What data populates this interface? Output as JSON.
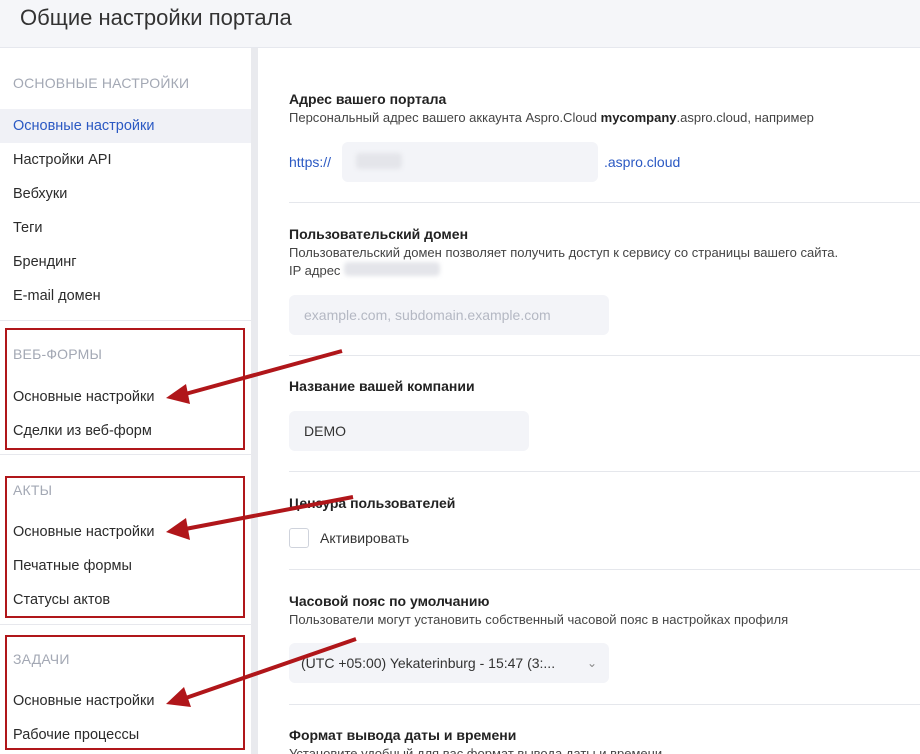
{
  "header": {
    "title": "Общие настройки портала"
  },
  "sidebar": {
    "sections": [
      {
        "title": "ОСНОВНЫЕ НАСТРОЙКИ",
        "items": [
          "Основные настройки",
          "Настройки API",
          "Вебхуки",
          "Теги",
          "Брендинг",
          "E-mail домен"
        ]
      },
      {
        "title": "ВЕБ-ФОРМЫ",
        "items": [
          "Основные настройки",
          "Сделки из веб-форм"
        ]
      },
      {
        "title": "АКТЫ",
        "items": [
          "Основные настройки",
          "Печатные формы",
          "Статусы актов"
        ]
      },
      {
        "title": "ЗАДАЧИ",
        "items": [
          "Основные настройки",
          "Рабочие процессы"
        ]
      }
    ]
  },
  "main": {
    "portal": {
      "label": "Адрес вашего портала",
      "desc_prefix": "Персональный адрес вашего аккаунта Aspro.Cloud ",
      "desc_bold": "mycompany",
      "desc_suffix": ".aspro.cloud, например",
      "prefix": "https://",
      "suffix": ".aspro.cloud"
    },
    "domain": {
      "label": "Пользовательский домен",
      "desc": "Пользовательский домен позволяет получить доступ к сервису со страницы вашего сайта.",
      "ip_label": "IP адрес",
      "placeholder": "example.com, subdomain.example.com"
    },
    "company": {
      "label": "Название вашей компании",
      "value": "DEMO"
    },
    "censor": {
      "label": "Цензура пользователей",
      "checkbox_label": "Активировать"
    },
    "timezone": {
      "label": "Часовой пояс по умолчанию",
      "desc": "Пользователи могут установить собственный часовой пояс в настройках профиля",
      "value": "(UTC +05:00) Yekaterinburg - 15:47 (3:...",
      "chevron": "chevron-down-icon"
    },
    "datetime": {
      "label": "Формат вывода даты и времени",
      "desc": "Установите удобный для вас формат вывода даты и времени"
    }
  },
  "colors": {
    "accent": "#2b59c3",
    "annotation_red": "#b0161a"
  }
}
